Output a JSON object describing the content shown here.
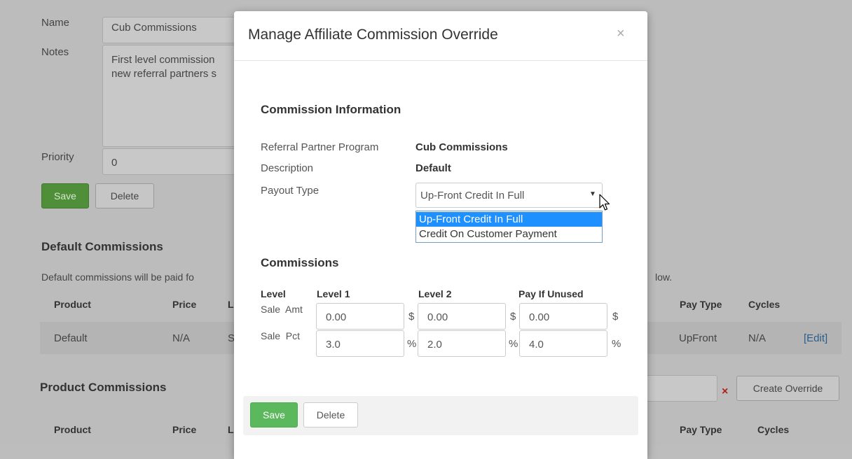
{
  "background": {
    "name_label": "Name",
    "name_value": "Cub Commissions",
    "notes_label": "Notes",
    "notes_line1": "First level commission",
    "notes_line2": "new referral partners s",
    "priority_label": "Priority",
    "priority_value": "0",
    "save_label": "Save",
    "delete_label": "Delete",
    "default_commissions_heading": "Default Commissions",
    "default_desc_start": "Default commissions will be paid fo",
    "default_desc_end": "low.",
    "table_headers": {
      "product": "Product",
      "price": "Price",
      "l": "L",
      "pay_type": "Pay Type",
      "cycles": "Cycles"
    },
    "default_row": {
      "product": "Default",
      "price": "N/A",
      "s": "S",
      "pay_type": "UpFront",
      "cycles": "N/A",
      "edit": "[Edit]"
    },
    "product_commissions_heading": "Product Commissions",
    "create_override_label": "Create Override",
    "remove_icon": "×",
    "colors": {
      "green": "#5cb85c",
      "link": "#2a6496",
      "remove": "#c9302c"
    }
  },
  "modal": {
    "title": "Manage Affiliate Commission Override",
    "close_icon": "×",
    "commission_information_heading": "Commission Information",
    "referral_program_label": "Referral Partner Program",
    "referral_program_value": "Cub Commissions",
    "description_label": "Description",
    "description_value": "Default",
    "payout_type_label": "Payout Type",
    "payout_type_selected": "Up-Front Credit In Full",
    "payout_options": [
      "Up-Front Credit In Full",
      "Credit On Customer Payment"
    ],
    "commissions_heading": "Commissions",
    "level_header": "Level",
    "level1_header": "Level 1",
    "level2_header": "Level 2",
    "pay_if_unused_header": "Pay If Unused",
    "sale_amt_label": "Sale  Amt",
    "sale_pct_label": "Sale  Pct",
    "amt_values": [
      "0.00",
      "0.00",
      "0.00"
    ],
    "pct_values": [
      "3.0",
      "2.0",
      "4.0"
    ],
    "dollar_unit": "$",
    "percent_unit": "%",
    "save_label": "Save",
    "delete_label": "Delete"
  }
}
